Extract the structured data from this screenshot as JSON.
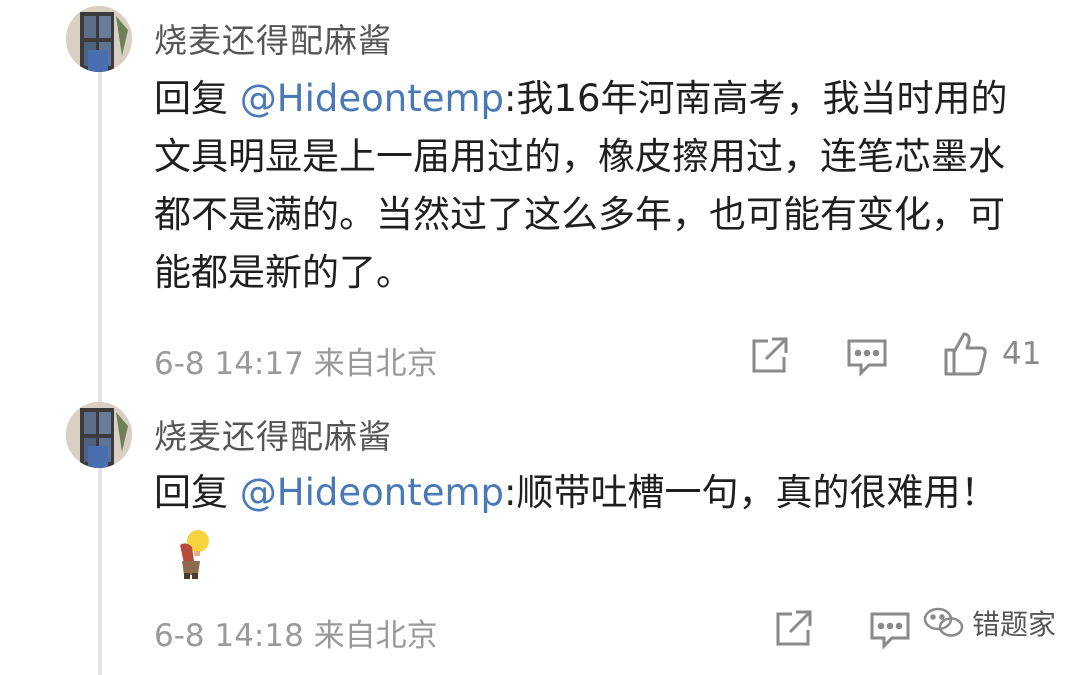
{
  "comments": [
    {
      "username": "烧麦还得配麻酱",
      "reply_prefix": "回复 ",
      "mention": "@Hideontemp",
      "text": ":我16年河南高考，我当时用的文具明显是上一届用过的，橡皮擦用过，连笔芯墨水都不是满的。当然过了这么多年，也可能有变化，可能都是新的了。",
      "time": "6-8 14:17",
      "location": "来自北京",
      "likes": "41",
      "icons": [
        "edit-icon",
        "reply-icon",
        "thumbs-up-icon"
      ]
    },
    {
      "username": "烧麦还得配麻酱",
      "reply_prefix": "回复 ",
      "mention": "@Hideontemp",
      "text": ":顺带吐槽一句，真的很难用！",
      "emoji": "doge-emoji",
      "time": "6-8 14:18",
      "location": "来自北京",
      "icons": [
        "edit-icon",
        "reply-icon"
      ]
    }
  ],
  "watermark": {
    "text": "错题家",
    "icon": "wechat-icon"
  },
  "colors": {
    "mention": "#4a79b7",
    "meta": "#9a9a9a",
    "username": "#555555"
  }
}
